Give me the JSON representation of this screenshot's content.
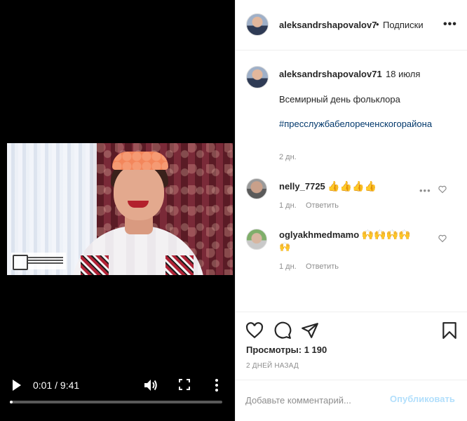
{
  "video": {
    "current_time": "0:01",
    "separator": " / ",
    "duration": "9:41",
    "progress_fraction": 0.002
  },
  "post": {
    "username": "aleksandrshapovalov7",
    "dot": "•",
    "follow_label": "Подписки",
    "more_label": "•••",
    "caption": {
      "username": "aleksandrshapovalov71",
      "date": "18 июля",
      "text": "Всемирный день фольклора",
      "hashtag": "#пресслужбабелореченскогорайона",
      "age": "2 дн."
    },
    "comments": [
      {
        "username": "nelly_7725",
        "text": "👍👍👍👍",
        "age": "1 дн.",
        "reply_label": "Ответить",
        "more_label": "•••"
      },
      {
        "username": "oglyakhmedmamo",
        "text": "🙌🙌🙌🙌",
        "text_cont": "🙌",
        "age": "1 дн.",
        "reply_label": "Ответить"
      }
    ],
    "views_label": "Просмотры: 1 190",
    "posted_label": "2 ДНЕЙ НАЗАД",
    "comment_placeholder": "Добавьте комментарий...",
    "publish_label": "Опубликовать"
  },
  "icons": {
    "play": "play-icon",
    "volume": "volume-icon",
    "fullscreen": "fullscreen-icon",
    "more": "more-vertical-icon",
    "heart": "heart-icon",
    "comment": "comment-icon",
    "share": "share-icon",
    "save": "bookmark-icon"
  },
  "colors": {
    "link": "#00376b",
    "muted": "#8e8e8e",
    "publish_disabled": "#b2dffc"
  }
}
